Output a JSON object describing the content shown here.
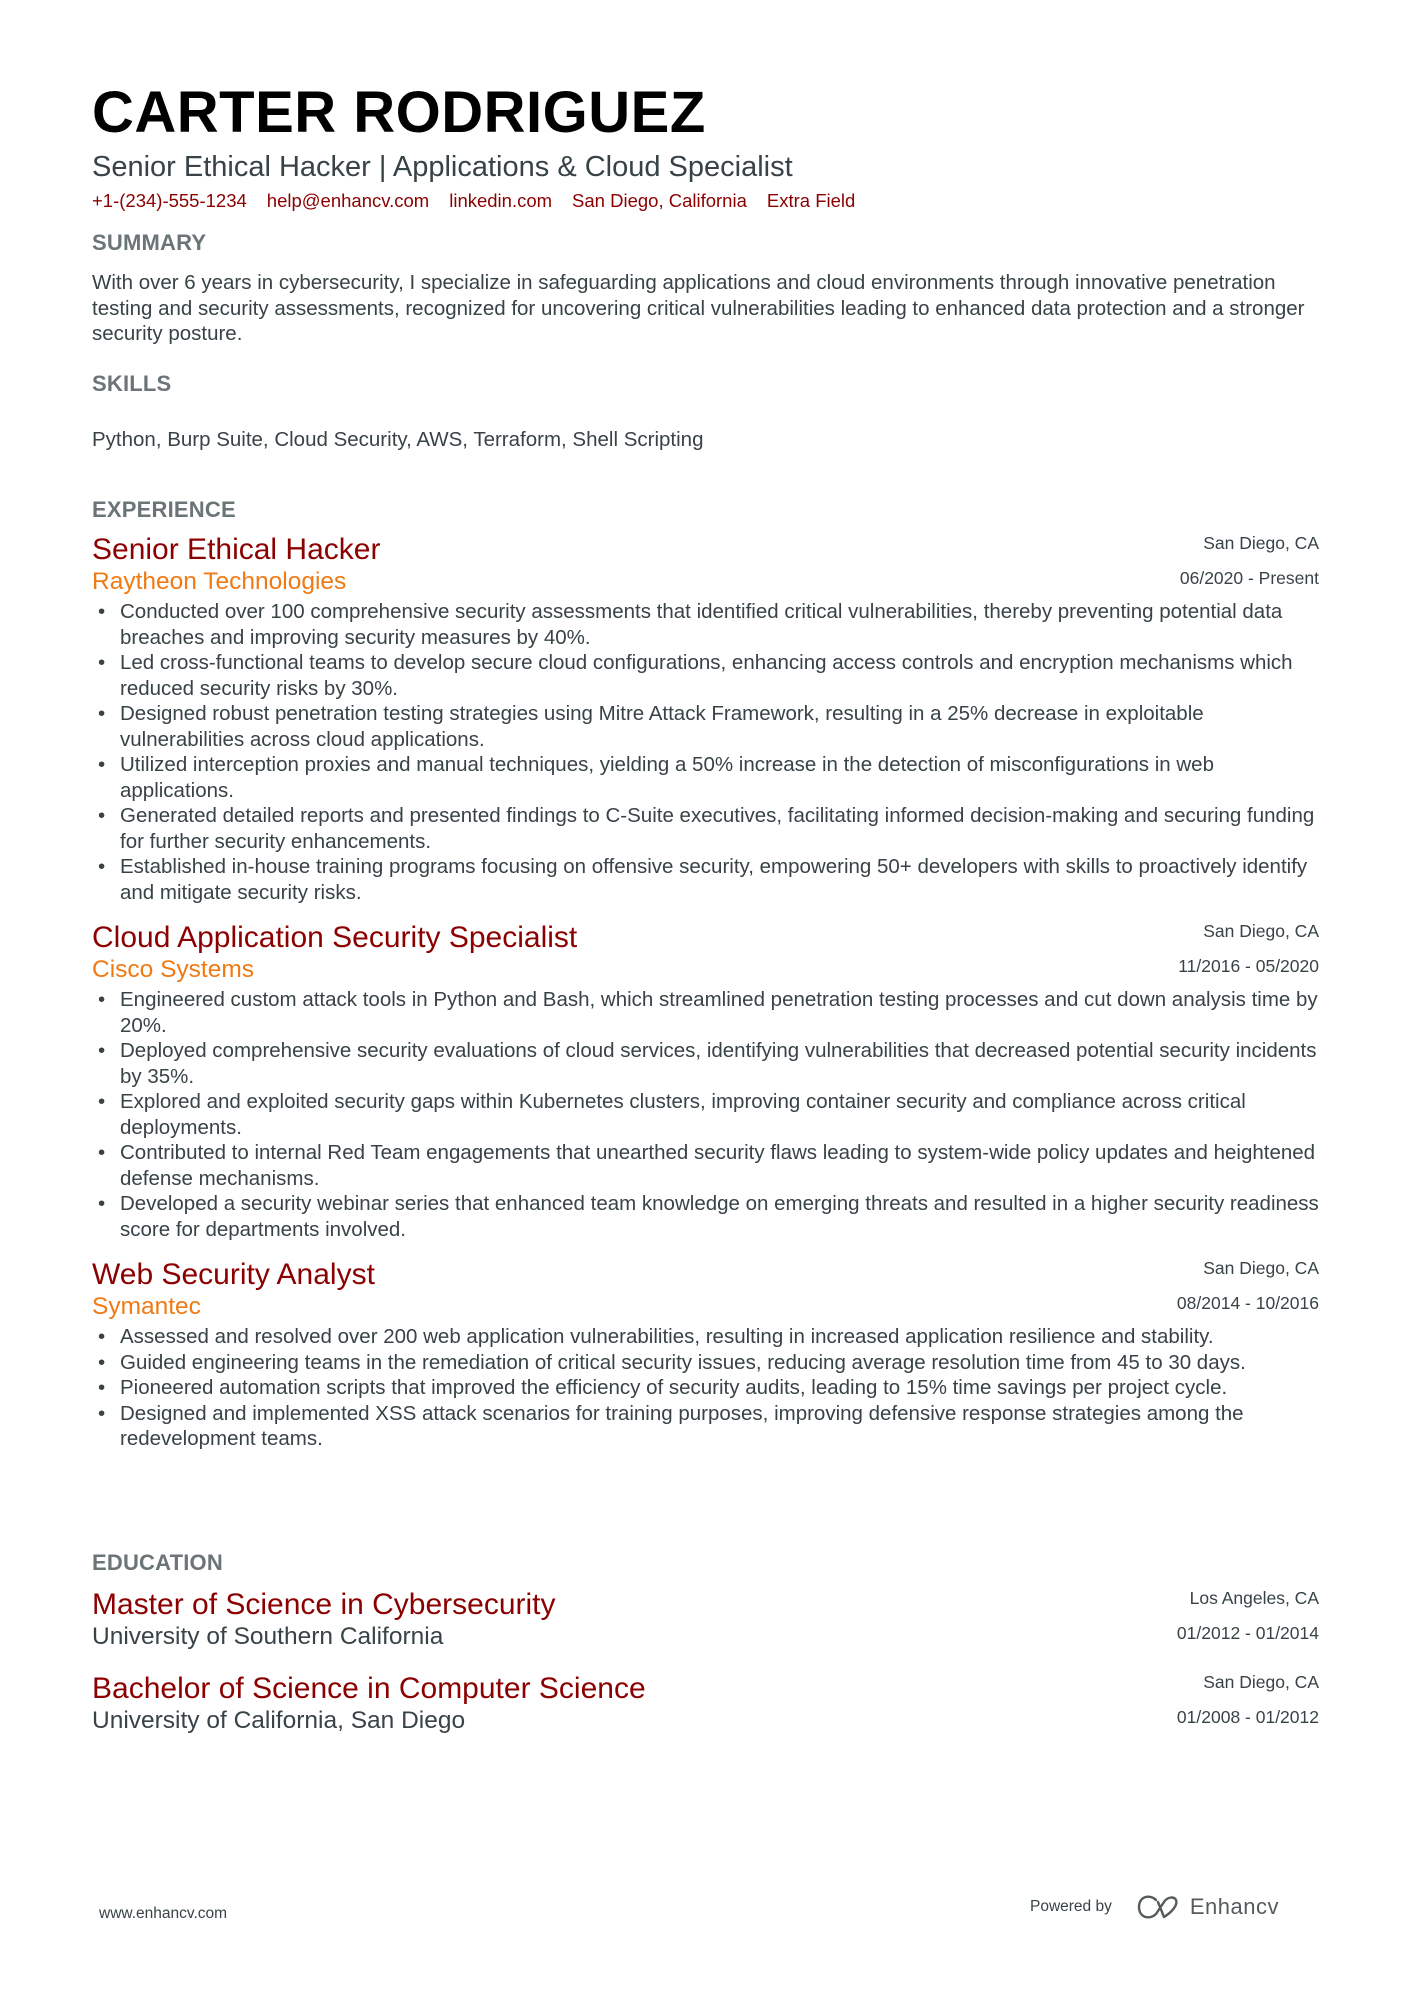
{
  "header": {
    "name": "CARTER RODRIGUEZ",
    "title": "Senior Ethical Hacker | Applications & Cloud Specialist",
    "contacts": [
      "+1-(234)-555-1234",
      "help@enhancv.com",
      "linkedin.com",
      "San Diego, California",
      "Extra Field"
    ]
  },
  "summary": {
    "heading": "SUMMARY",
    "text": "With over 6 years in cybersecurity, I specialize in safeguarding applications and cloud environments through innovative penetration testing and security assessments, recognized for uncovering critical vulnerabilities leading to enhanced data protection and a stronger security posture."
  },
  "skills": {
    "heading": "SKILLS",
    "text": "Python, Burp Suite, Cloud Security, AWS, Terraform, Shell Scripting"
  },
  "experience": {
    "heading": "EXPERIENCE",
    "entries": [
      {
        "role": "Senior Ethical Hacker",
        "company": "Raytheon Technologies",
        "location": "San Diego, CA",
        "dates": "06/2020 - Present",
        "bullets": [
          "Conducted over 100 comprehensive security assessments that identified critical vulnerabilities, thereby preventing potential data breaches and improving security measures by 40%.",
          "Led cross-functional teams to develop secure cloud configurations, enhancing access controls and encryption mechanisms which reduced security risks by 30%.",
          "Designed robust penetration testing strategies using Mitre Attack Framework, resulting in a 25% decrease in exploitable vulnerabilities across cloud applications.",
          "Utilized interception proxies and manual techniques, yielding a 50% increase in the detection of misconfigurations in web applications.",
          "Generated detailed reports and presented findings to C-Suite executives, facilitating informed decision-making and securing funding for further security enhancements.",
          "Established in-house training programs focusing on offensive security, empowering 50+ developers with skills to proactively identify and mitigate security risks."
        ]
      },
      {
        "role": "Cloud Application Security Specialist",
        "company": "Cisco Systems",
        "location": "San Diego, CA",
        "dates": "11/2016 - 05/2020",
        "bullets": [
          "Engineered custom attack tools in Python and Bash, which streamlined penetration testing processes and cut down analysis time by 20%.",
          "Deployed comprehensive security evaluations of cloud services, identifying vulnerabilities that decreased potential security incidents by 35%.",
          "Explored and exploited security gaps within Kubernetes clusters, improving container security and compliance across critical deployments.",
          "Contributed to internal Red Team engagements that unearthed security flaws leading to system-wide policy updates and heightened defense mechanisms.",
          "Developed a security webinar series that enhanced team knowledge on emerging threats and resulted in a higher security readiness score for departments involved."
        ]
      },
      {
        "role": "Web Security Analyst",
        "company": "Symantec",
        "location": "San Diego, CA",
        "dates": "08/2014 - 10/2016",
        "bullets": [
          "Assessed and resolved over 200 web application vulnerabilities, resulting in increased application resilience and stability.",
          "Guided engineering teams in the remediation of critical security issues, reducing average resolution time from 45 to 30 days.",
          "Pioneered automation scripts that improved the efficiency of security audits, leading to 15% time savings per project cycle.",
          "Designed and implemented XSS attack scenarios for training purposes, improving defensive response strategies among the redevelopment teams."
        ]
      }
    ]
  },
  "education": {
    "heading": "EDUCATION",
    "entries": [
      {
        "degree": "Master of Science in Cybersecurity",
        "school": "University of Southern California",
        "location": "Los Angeles, CA",
        "dates": "01/2012 - 01/2014"
      },
      {
        "degree": "Bachelor of Science in Computer Science",
        "school": "University of California, San Diego",
        "location": "San Diego, CA",
        "dates": "01/2008 - 01/2012"
      }
    ]
  },
  "footer": {
    "website": "www.enhancv.com",
    "powered_by": "Powered by",
    "brand": "Enhancv",
    "brand_icon": "enhancv-logo-icon"
  },
  "colors": {
    "accent_dark_red": "#8b0000",
    "accent_orange": "#f07a14",
    "heading_gray": "#6b7476",
    "body_text": "#384347"
  }
}
